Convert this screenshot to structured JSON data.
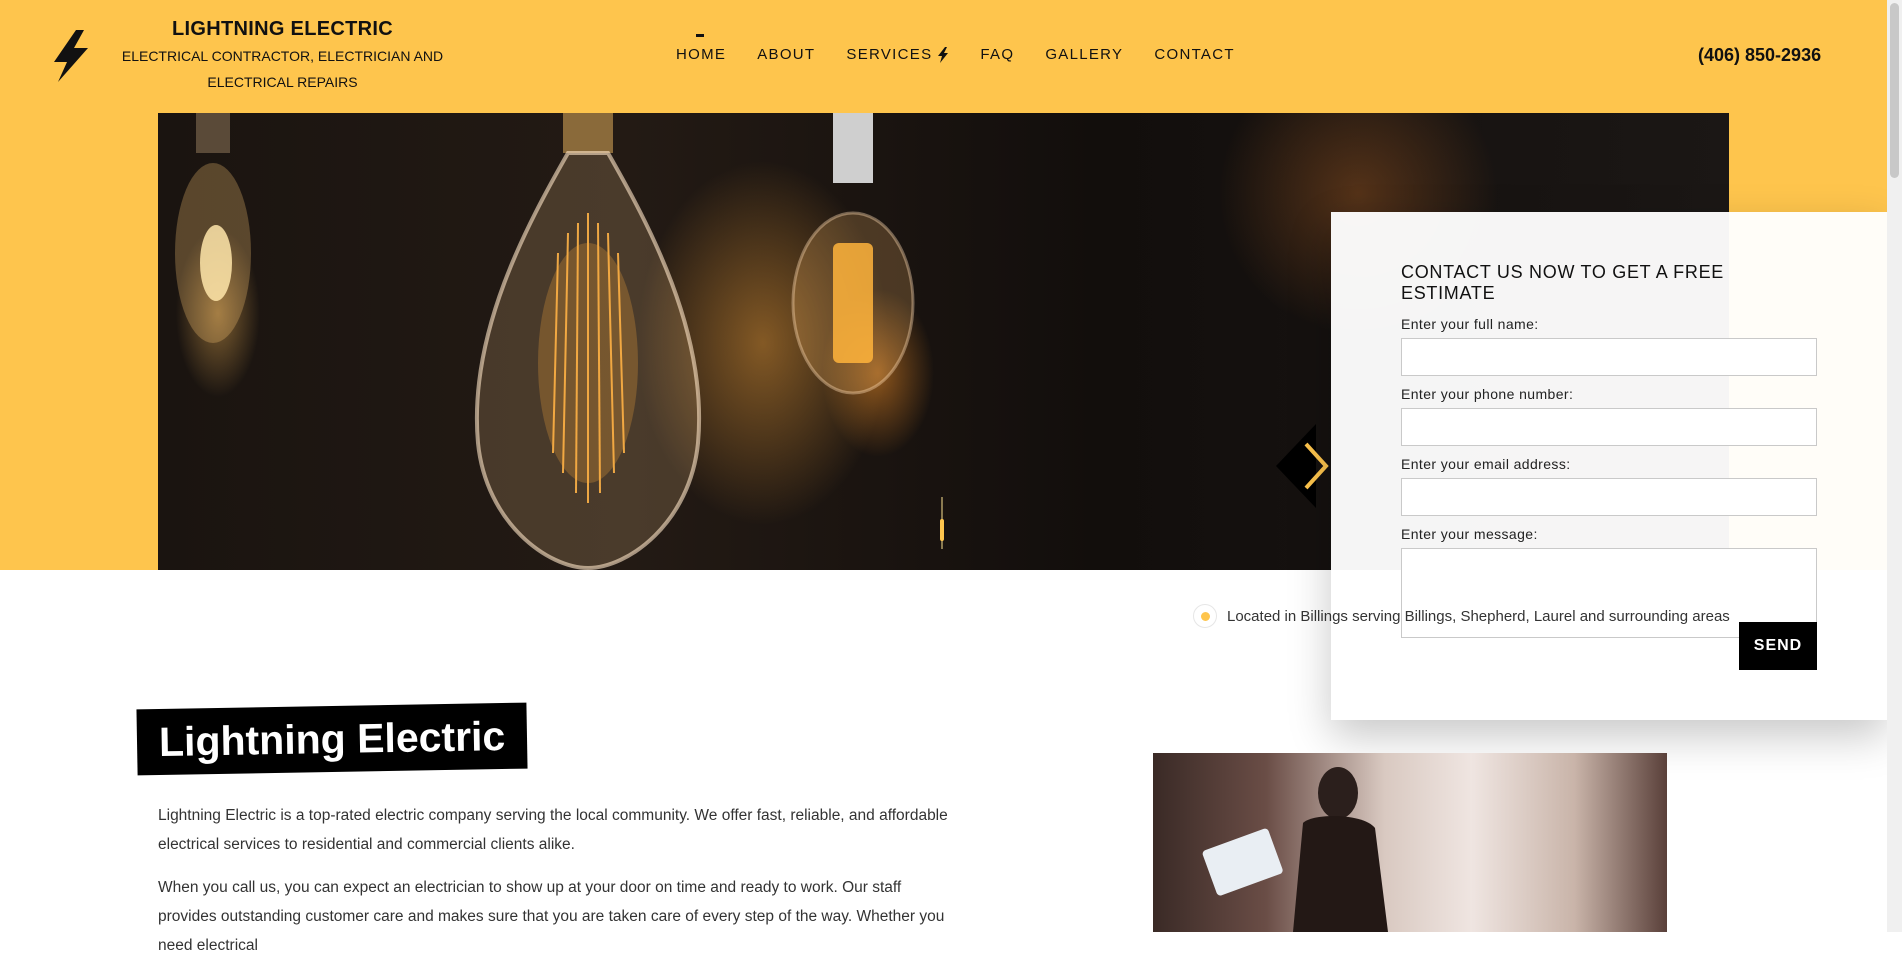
{
  "header": {
    "brand_name": "LIGHTNING ELECTRIC",
    "tagline_line1": "ELECTRICAL CONTRACTOR, ELECTRICIAN AND",
    "tagline_line2": "ELECTRICAL REPAIRS",
    "phone": "(406) 850-2936",
    "logo_icon": "lightning-bolt-icon"
  },
  "nav": {
    "items": [
      {
        "label": "HOME",
        "active": true
      },
      {
        "label": "ABOUT"
      },
      {
        "label": "SERVICES",
        "icon": "lightning-bolt-icon"
      },
      {
        "label": "FAQ"
      },
      {
        "label": "GALLERY"
      },
      {
        "label": "CONTACT"
      }
    ]
  },
  "hero": {
    "next_icon": "chevron-right-icon"
  },
  "contact_form": {
    "title": "CONTACT US NOW TO GET A FREE ESTIMATE",
    "name_label": "Enter your full name:",
    "phone_label": "Enter your phone number:",
    "email_label": "Enter your email address:",
    "message_label": "Enter your message:",
    "name_value": "",
    "phone_value": "",
    "email_value": "",
    "message_value": "",
    "send_label": "SEND"
  },
  "location": {
    "text": "Located in Billings serving Billings, Shepherd, Laurel and surrounding areas"
  },
  "about": {
    "title": "Lightning Electric",
    "paragraph1": "Lightning Electric is a top-rated electric company serving the local community. We offer fast, reliable, and affordable electrical services to residential and commercial clients alike.",
    "paragraph2": "When you call us, you can expect an electrician to show up at your door on time and ready to work. Our staff provides outstanding customer care and makes sure that you are taken care of every step of the way. Whether you need electrical"
  },
  "colors": {
    "brand_yellow": "#fec54d",
    "black": "#000000"
  }
}
